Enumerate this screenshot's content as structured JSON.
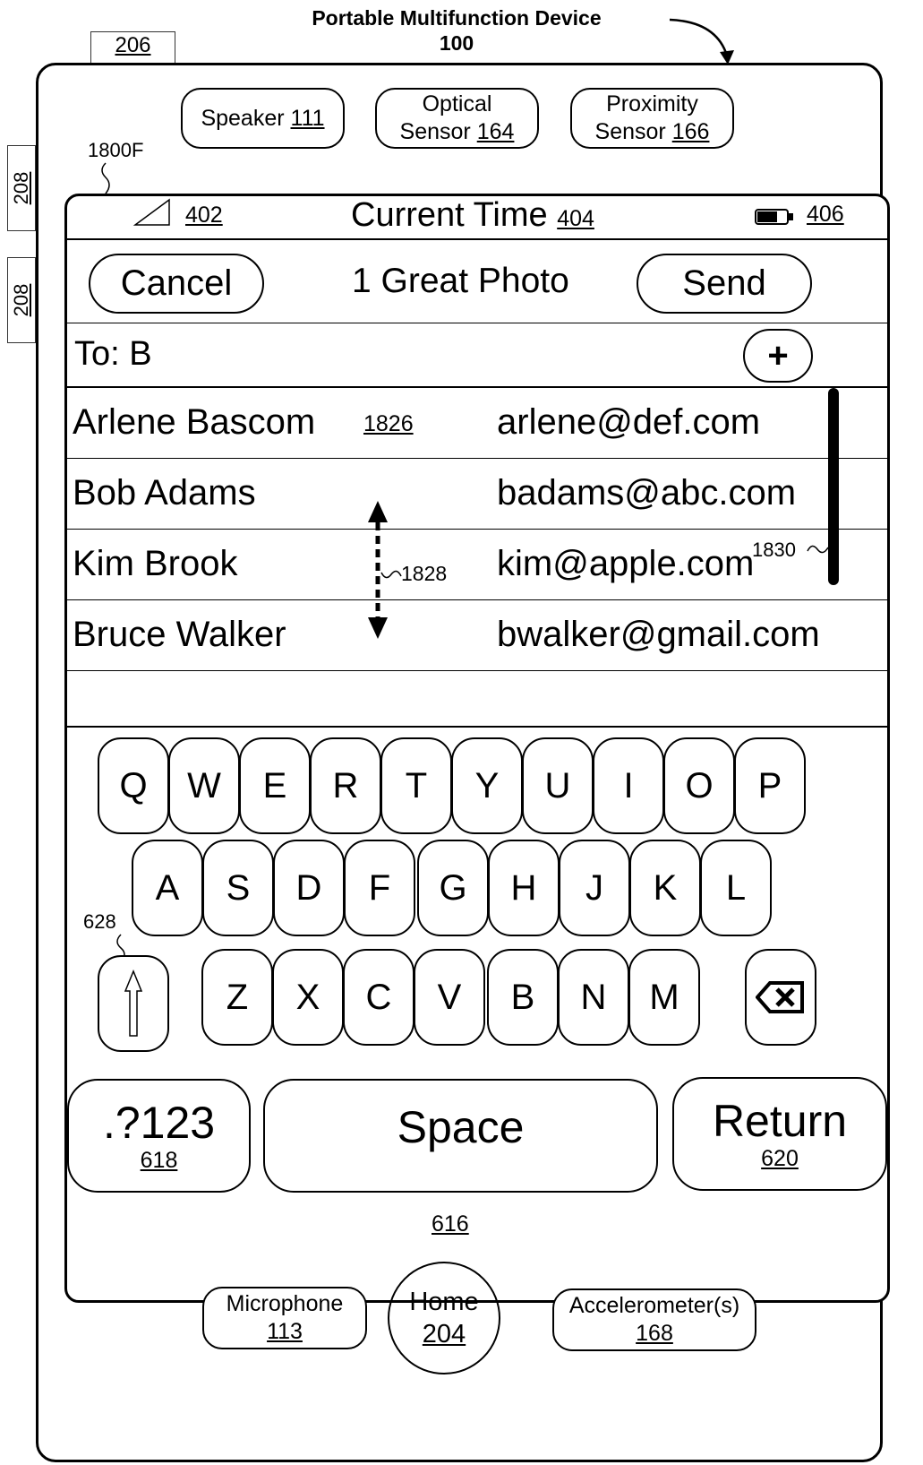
{
  "figure": {
    "title_line1": "Portable Multifunction Device",
    "title_line2": "100",
    "ref_206": "206",
    "ref_208_a": "208",
    "ref_208_b": "208",
    "ref_1800f": "1800F",
    "ref_628": "628"
  },
  "hardware": {
    "speaker": {
      "label": "Speaker ",
      "ref": "111"
    },
    "optical_sensor": {
      "label": "Optical",
      "label2": "Sensor ",
      "ref": "164"
    },
    "proximity_sensor": {
      "label": "Proximity",
      "label2": "Sensor ",
      "ref": "166"
    },
    "microphone": {
      "label": "Microphone",
      "ref": "113"
    },
    "home": {
      "label": "Home",
      "ref": "204"
    },
    "accelerometer": {
      "label": "Accelerometer(s)",
      "ref": "168"
    }
  },
  "status_bar": {
    "signal_ref": "402",
    "time_label": "Current Time",
    "time_ref": "404",
    "battery_ref": "406"
  },
  "nav": {
    "cancel": "Cancel",
    "title": "1 Great Photo",
    "send": "Send"
  },
  "to_field": {
    "value": "To: B",
    "add": "+"
  },
  "contacts": [
    {
      "name": "Arlene Bascom",
      "ref": "1826",
      "email": "arlene@def.com"
    },
    {
      "name": "Bob Adams",
      "email": "badams@abc.com"
    },
    {
      "name": "Kim Brook",
      "email": "kim@apple.com"
    },
    {
      "name": "Bruce Walker",
      "email": "bwalker@gmail.com"
    }
  ],
  "annotations": {
    "scroll_gesture_ref": "1828",
    "scroll_bar_ref": "1830"
  },
  "keyboard": {
    "row1": [
      "Q",
      "W",
      "E",
      "R",
      "T",
      "Y",
      "U",
      "I",
      "O",
      "P"
    ],
    "row2": [
      "A",
      "S",
      "D",
      "F",
      "G",
      "H",
      "J",
      "K",
      "L"
    ],
    "row3": [
      "Z",
      "X",
      "C",
      "V",
      "B",
      "N",
      "M"
    ],
    "numbers": {
      "label": ".?123",
      "ref": "618"
    },
    "space": "Space",
    "return": {
      "label": "Return",
      "ref": "620"
    },
    "keyboard_ref": "616",
    "shift_icon": "up-arrow-icon",
    "backspace_icon": "backspace-icon"
  }
}
